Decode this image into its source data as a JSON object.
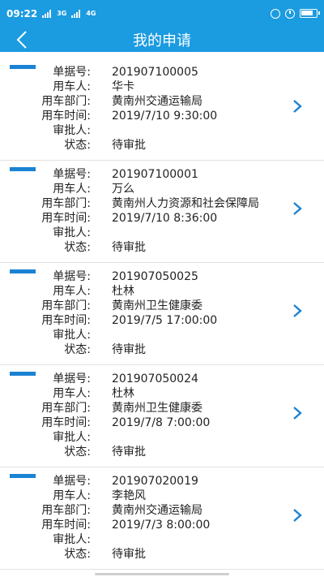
{
  "status_bar": {
    "time": "09:22",
    "network_1": "3G",
    "network_2": "4G"
  },
  "header": {
    "title": "我的申请"
  },
  "labels": {
    "doc_no": "单据号:",
    "user": "用车人:",
    "dept": "用车部门:",
    "time": "用车时间:",
    "approver": "审批人:",
    "status": "状态:"
  },
  "items": [
    {
      "doc_no": "201907100005",
      "user": "华卡",
      "dept": "黄南州交通运输局",
      "time": "2019/7/10 9:30:00",
      "approver": "",
      "status": "待审批"
    },
    {
      "doc_no": "201907100001",
      "user": "万么",
      "dept": "黄南州人力资源和社会保障局",
      "time": "2019/7/10 8:36:00",
      "approver": "",
      "status": "待审批"
    },
    {
      "doc_no": "201907050025",
      "user": "杜林",
      "dept": "黄南州卫生健康委",
      "time": "2019/7/5 17:00:00",
      "approver": "",
      "status": "待审批"
    },
    {
      "doc_no": "201907050024",
      "user": "杜林",
      "dept": "黄南州卫生健康委",
      "time": "2019/7/8 7:00:00",
      "approver": "",
      "status": "待审批"
    },
    {
      "doc_no": "201907020019",
      "user": "李艳风",
      "dept": "黄南州交通运输局",
      "time": "2019/7/3 8:00:00",
      "approver": "",
      "status": "待审批"
    }
  ],
  "colors": {
    "primary": "#1b9be0",
    "marker": "#1b83d4",
    "chevron": "#1b83d4"
  }
}
